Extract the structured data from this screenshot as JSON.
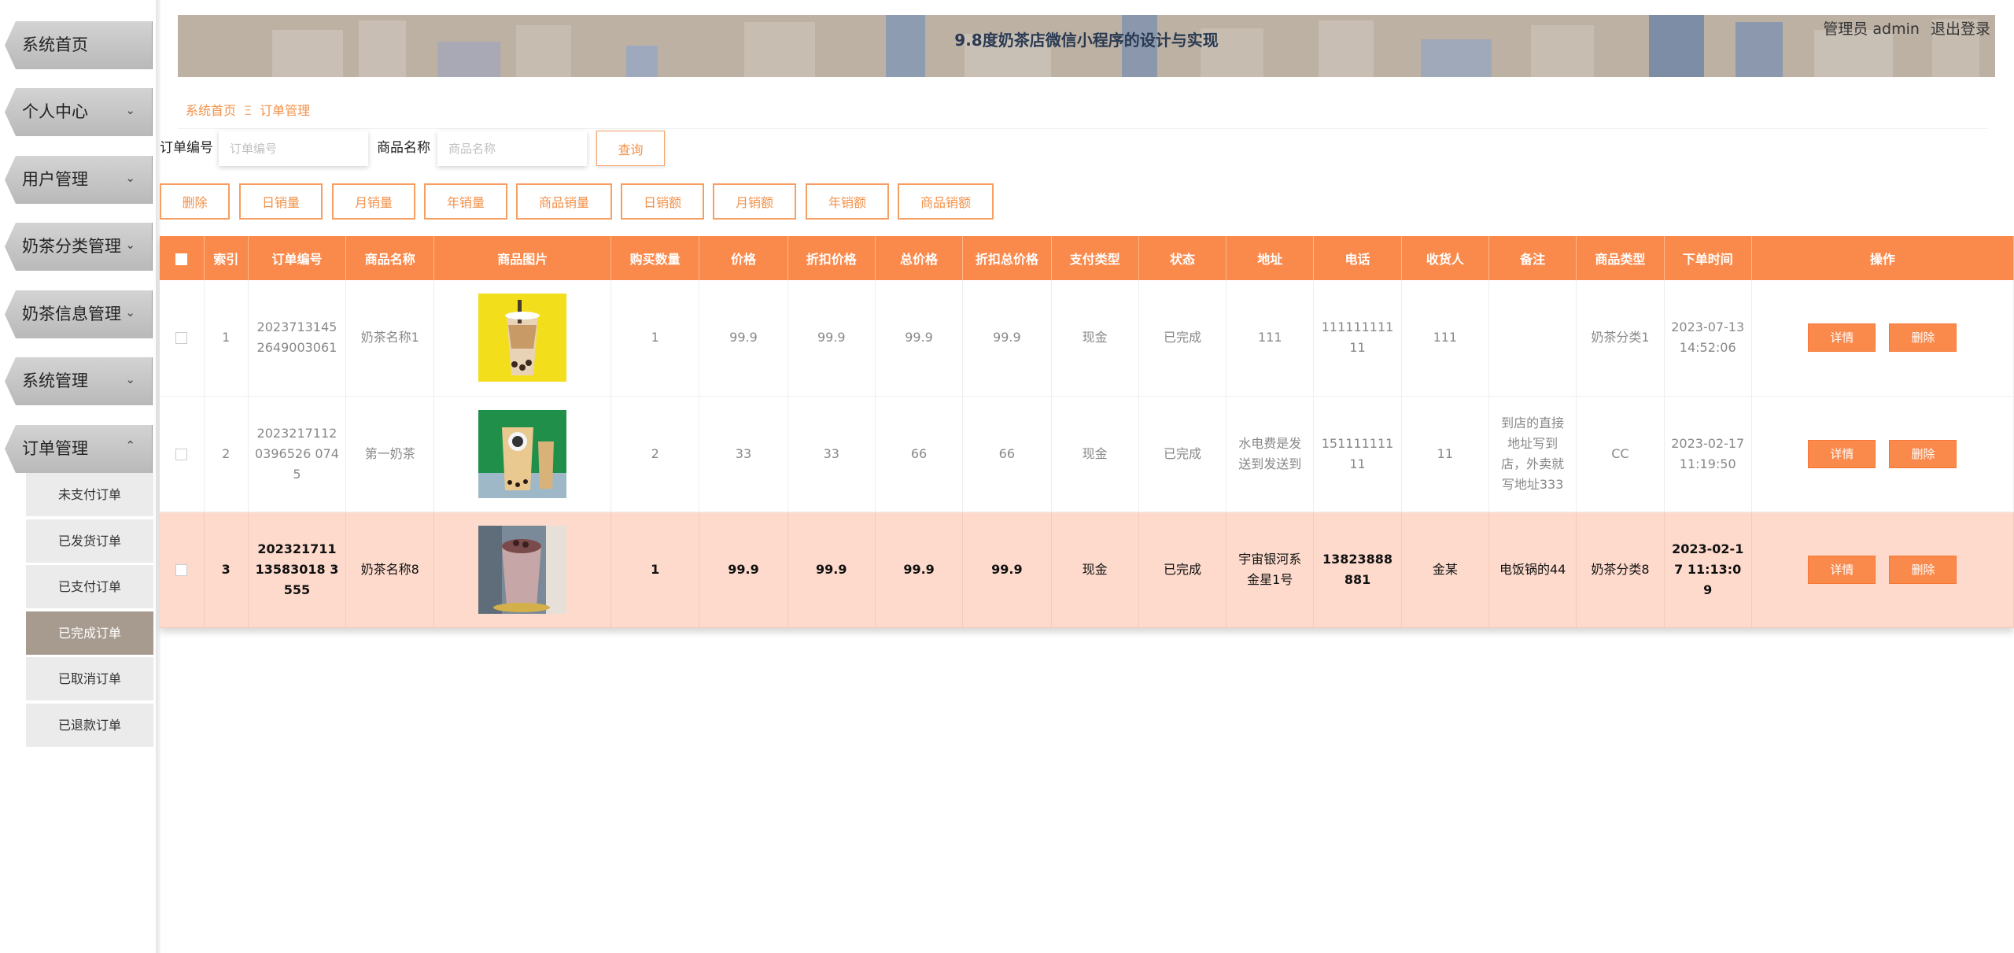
{
  "app": {
    "title": "9.8度奶茶店微信小程序的设计与实现",
    "user_role": "管理员 admin",
    "logout": "退出登录"
  },
  "sidebar": {
    "items": [
      {
        "label": "系统首页",
        "has_chevron": false
      },
      {
        "label": "个人中心",
        "has_chevron": true
      },
      {
        "label": "用户管理",
        "has_chevron": true
      },
      {
        "label": "奶茶分类管理",
        "has_chevron": true
      },
      {
        "label": "奶茶信息管理",
        "has_chevron": true
      },
      {
        "label": "系统管理",
        "has_chevron": true
      },
      {
        "label": "订单管理",
        "has_chevron": true,
        "expanded": true
      }
    ],
    "sub_items": [
      {
        "label": "未支付订单"
      },
      {
        "label": "已发货订单"
      },
      {
        "label": "已支付订单"
      },
      {
        "label": "已完成订单",
        "active": true
      },
      {
        "label": "已取消订单"
      },
      {
        "label": "已退款订单"
      }
    ]
  },
  "breadcrumb": {
    "home": "系统首页",
    "separator": "Ξ",
    "current": "订单管理"
  },
  "search": {
    "order_no_label": "订单编号",
    "order_no_placeholder": "订单编号",
    "product_name_label": "商品名称",
    "product_name_placeholder": "商品名称",
    "query_button": "查询"
  },
  "actions": [
    "删除",
    "日销量",
    "月销量",
    "年销量",
    "商品销量",
    "日销额",
    "月销额",
    "年销额",
    "商品销额"
  ],
  "table": {
    "columns": [
      "索引",
      "订单编号",
      "商品名称",
      "商品图片",
      "购买数量",
      "价格",
      "折扣价格",
      "总价格",
      "折扣总价格",
      "支付类型",
      "状态",
      "地址",
      "电话",
      "收货人",
      "备注",
      "商品类型",
      "下单时间",
      "操作"
    ],
    "rows": [
      {
        "index": "1",
        "order_no": "20237131452649003061",
        "name": "奶茶名称1",
        "image": "bubble-tea-yellow-bg",
        "qty": "1",
        "price": "99.9",
        "discount_price": "99.9",
        "total": "99.9",
        "discount_total": "99.9",
        "pay_type": "现金",
        "status": "已完成",
        "address": "111",
        "phone": "11111111111",
        "receiver": "111",
        "remark": "",
        "category": "奶茶分类1",
        "time": "2023-07-13 14:52:06",
        "highlight": false
      },
      {
        "index": "2",
        "order_no": "20232171120396526 0745",
        "name": "第一奶茶",
        "image": "milk-tea-green-bg",
        "qty": "2",
        "price": "33",
        "discount_price": "33",
        "total": "66",
        "discount_total": "66",
        "pay_type": "现金",
        "status": "已完成",
        "address": "水电费是发送到发送到",
        "phone": "15111111111",
        "receiver": "11",
        "remark": "到店的直接地址写到店，外卖就写地址333",
        "category": "CC",
        "time": "2023-02-17 11:19:50",
        "highlight": false
      },
      {
        "index": "3",
        "order_no": "20232171113583018 3555",
        "name": "奶茶名称8",
        "image": "taro-milk-tea",
        "qty": "1",
        "price": "99.9",
        "discount_price": "99.9",
        "total": "99.9",
        "discount_total": "99.9",
        "pay_type": "现金",
        "status": "已完成",
        "address": "宇宙银河系金星1号",
        "phone": "13823888881",
        "receiver": "金某",
        "remark": "电饭锅的44",
        "category": "奶茶分类8",
        "time": "2023-02-17 11:13:09",
        "highlight": true
      }
    ],
    "detail_button": "详情",
    "delete_button": "删除"
  },
  "colors": {
    "accent": "#fa8a4c",
    "highlight_row": "#fddacc",
    "sidebar_active": "#a79b90"
  }
}
